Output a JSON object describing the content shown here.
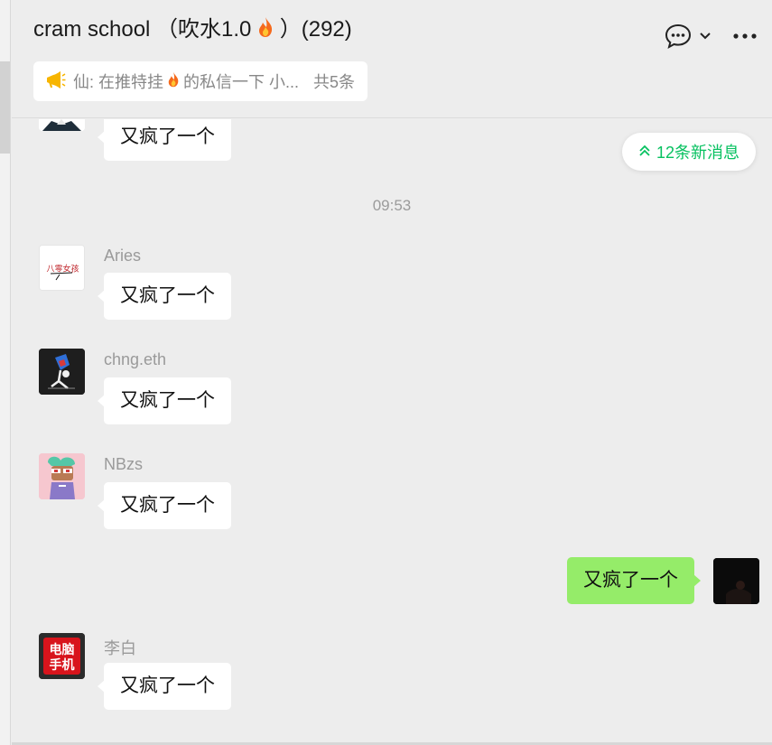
{
  "header": {
    "title_prefix": "cram school （吹水1.0",
    "title_suffix": "）(292)",
    "chat_icon": "chat-bubble-icon",
    "dropdown_icon": "chevron-down-icon",
    "more_icon": "more-dots-icon"
  },
  "pinned": {
    "icon": "announcement-icon",
    "text_prefix": "仙: 在推特挂",
    "text_suffix": "的私信一下  小...",
    "count": "共5条"
  },
  "new_messages": {
    "icon": "double-chevron-up-icon",
    "label": "12条新消息"
  },
  "timestamp": "09:53",
  "messages": [
    {
      "sender": "",
      "text": "又疯了一个",
      "mine": false
    },
    {
      "sender": "Aries",
      "text": "又疯了一个",
      "mine": false
    },
    {
      "sender": "chng.eth",
      "text": "又疯了一个",
      "mine": false
    },
    {
      "sender": "NBzs",
      "text": "又疯了一个",
      "mine": false
    },
    {
      "sender": "",
      "text": "又疯了一个",
      "mine": true
    },
    {
      "sender": "李白",
      "text": "又疯了一个",
      "mine": false
    }
  ],
  "avatar_li_bai": {
    "line1": "电脑",
    "line2": "手机"
  },
  "avatar_aries": {
    "text": "八零女孩"
  },
  "colors": {
    "background": "#ededed",
    "bubble_other": "#ffffff",
    "bubble_mine": "#95ec69",
    "accent_green": "#07c160"
  }
}
